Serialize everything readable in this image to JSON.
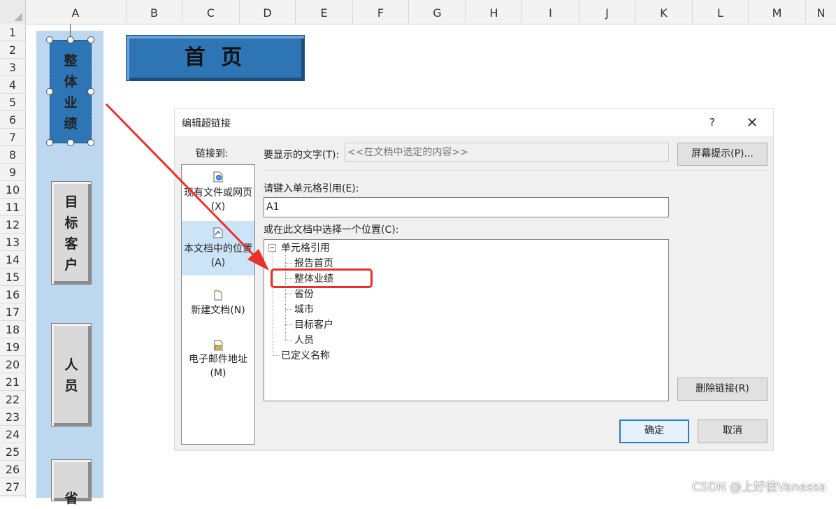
{
  "spreadsheet": {
    "columns": [
      "A",
      "B",
      "C",
      "D",
      "E",
      "F",
      "G",
      "H",
      "I",
      "J",
      "K",
      "L",
      "M",
      "N"
    ],
    "rows": [
      "1",
      "2",
      "3",
      "4",
      "5",
      "6",
      "7",
      "8",
      "9",
      "10",
      "11",
      "12",
      "13",
      "14",
      "15",
      "16",
      "17",
      "18",
      "19",
      "20",
      "21",
      "22",
      "23",
      "24",
      "25",
      "26",
      "27"
    ]
  },
  "sidebar": {
    "buttons": [
      {
        "label": [
          "整",
          "体",
          "业",
          "绩"
        ],
        "selected": true,
        "color": "#2e75b6"
      },
      {
        "label": [
          "目",
          "标",
          "客",
          "户"
        ],
        "selected": false,
        "color": "#d9d9d9"
      },
      {
        "label": [
          "人",
          "员"
        ],
        "selected": false,
        "color": "#d9d9d9"
      },
      {
        "label": [
          "省"
        ],
        "selected": false,
        "color": "#d9d9d9"
      }
    ],
    "background": "#bdd7ee"
  },
  "home_button": {
    "label": "首 页",
    "color": "#2e75b6"
  },
  "dialog": {
    "title": "编辑超链接",
    "help": "?",
    "close": "✕",
    "link_to_label": "链接到:",
    "link_to_items": [
      {
        "label": "现有文件或网页(X)",
        "icon": "web-file-icon"
      },
      {
        "label": "本文档中的位置(A)",
        "icon": "document-place-icon",
        "selected": true
      },
      {
        "label": "新建文档(N)",
        "icon": "new-document-icon"
      },
      {
        "label": "电子邮件地址(M)",
        "icon": "email-icon"
      }
    ],
    "display_text_label": "要显示的文字(T):",
    "display_text_value": "<<在文档中选定的内容>>",
    "screen_tip_button": "屏幕提示(P)...",
    "cell_ref_label": "请键入单元格引用(E):",
    "cell_ref_value": "A1",
    "place_label": "或在此文档中选择一个位置(C):",
    "tree": {
      "root": "单元格引用",
      "children": [
        "报告首页",
        "整体业绩",
        "省份",
        "城市",
        "目标客户",
        "人员"
      ],
      "defined_names": "已定义名称"
    },
    "remove_link_button": "删除链接(R)",
    "ok_button": "确定",
    "cancel_button": "取消"
  },
  "annotation": {
    "color": "#e8312a"
  },
  "watermark": "CSDN @上好佳Vanessa"
}
